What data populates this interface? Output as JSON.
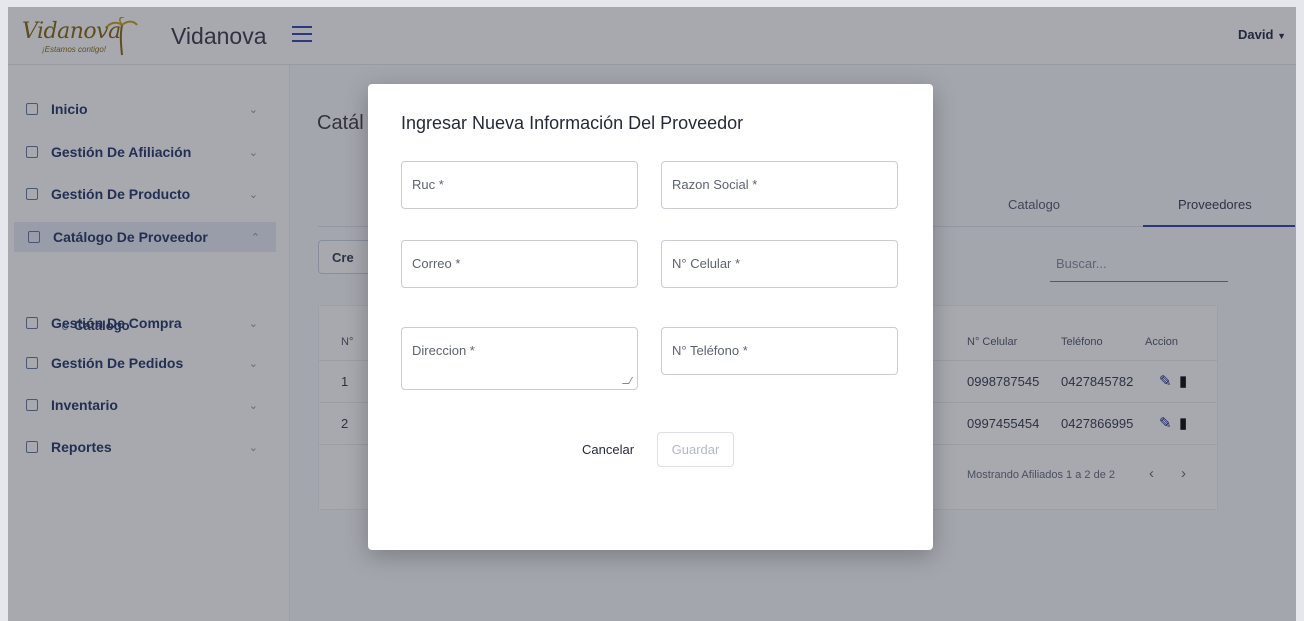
{
  "header": {
    "logo_script": "Vidanova",
    "logo_tagline": "¡Estamos contigo!",
    "brand": "Vidanova",
    "user": "David"
  },
  "sidebar": {
    "items": [
      {
        "label": "Inicio",
        "icon": "grid-icon",
        "expanded": false
      },
      {
        "label": "Gestión De Afiliación",
        "icon": "document-icon",
        "expanded": false
      },
      {
        "label": "Gestión De Producto",
        "icon": "box-icon",
        "expanded": false
      },
      {
        "label": "Catálogo De Proveedor",
        "icon": "document-icon",
        "expanded": true
      },
      {
        "label": "Gestión De Compra",
        "icon": "truck-icon",
        "expanded": false
      },
      {
        "label": "Gestión De Pedidos",
        "icon": "box-icon",
        "expanded": false
      },
      {
        "label": "Inventario",
        "icon": "list-icon",
        "expanded": false
      },
      {
        "label": "Reportes",
        "icon": "report-icon",
        "expanded": false
      }
    ],
    "subitem": "Catálogo"
  },
  "main": {
    "title": "Catál",
    "tabs": [
      "Catalogo",
      "Proveedores"
    ],
    "active_tab": "Proveedores",
    "create_label": "Cre",
    "search_placeholder": "Buscar...",
    "table": {
      "headers": [
        "N°",
        "N° Celular",
        "Teléfono",
        "Accion"
      ],
      "rows": [
        {
          "n": "1",
          "celular": "0998787545",
          "telefono": "0427845782"
        },
        {
          "n": "2",
          "celular": "0997455454",
          "telefono": "0427866995"
        }
      ],
      "footer": "Mostrando Afiliados 1 a 2 de 2"
    }
  },
  "modal": {
    "title": "Ingresar Nueva Información Del Proveedor",
    "fields": {
      "ruc": "Ruc *",
      "razon_social": "Razon Social *",
      "correo": "Correo *",
      "celular": "N° Celular *",
      "direccion": "Direccion *",
      "telefono": "N° Teléfono *"
    },
    "cancel": "Cancelar",
    "save": "Guardar"
  },
  "colors": {
    "accent": "#3949ab",
    "brand_gold": "#8a6d17",
    "nav_text": "#2a3b6b"
  }
}
